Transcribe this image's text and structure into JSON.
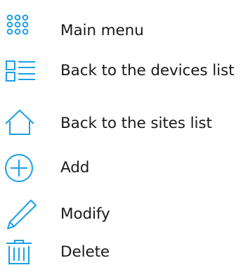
{
  "colors": {
    "icon": "#1aa0e8",
    "text": "#1a1a1a",
    "background": "#ffffff"
  },
  "legend": {
    "items": [
      {
        "icon": "grid-dots-icon",
        "label": "Main menu"
      },
      {
        "icon": "list-icon",
        "label": "Back to the devices list"
      },
      {
        "icon": "home-icon",
        "label": "Back to the sites list"
      },
      {
        "icon": "add-circle-icon",
        "label": "Add"
      },
      {
        "icon": "pencil-icon",
        "label": "Modify"
      },
      {
        "icon": "trash-icon",
        "label": "Delete"
      }
    ]
  }
}
